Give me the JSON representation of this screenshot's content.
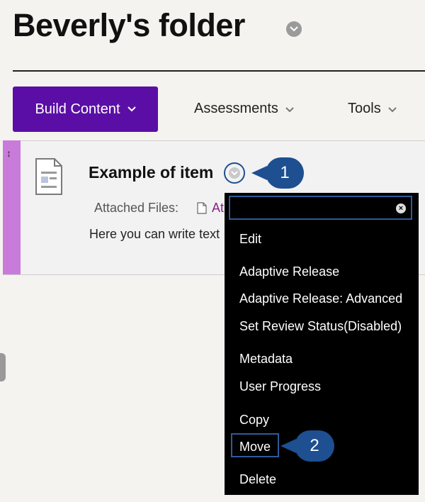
{
  "page": {
    "title": "Beverly's folder"
  },
  "toolbar": {
    "build_content": "Build Content",
    "assessments": "Assessments",
    "tools": "Tools"
  },
  "item": {
    "title": "Example of item",
    "attached_label": "Attached Files:",
    "attached_file_fragment": "At",
    "body_text": "Here you can write text"
  },
  "context_menu": {
    "search_value": "",
    "items": [
      "Edit",
      "Adaptive Release",
      "Adaptive Release: Advanced",
      "Set Review Status(Disabled)",
      "Metadata",
      "User Progress",
      "Copy",
      "Move",
      "Delete"
    ]
  },
  "callouts": {
    "first": "1",
    "second": "2"
  },
  "colors": {
    "accent": "#5b0ea6",
    "callout": "#1d4f91",
    "drag_strip": "#c97bdc",
    "menu_bg": "#000000"
  },
  "icons": {
    "title_menu": "chevron-down-icon",
    "item_menu": "chevron-down-icon",
    "document": "document-icon",
    "file": "file-icon",
    "drag": "drag-handle-icon",
    "clear": "clear-icon"
  }
}
